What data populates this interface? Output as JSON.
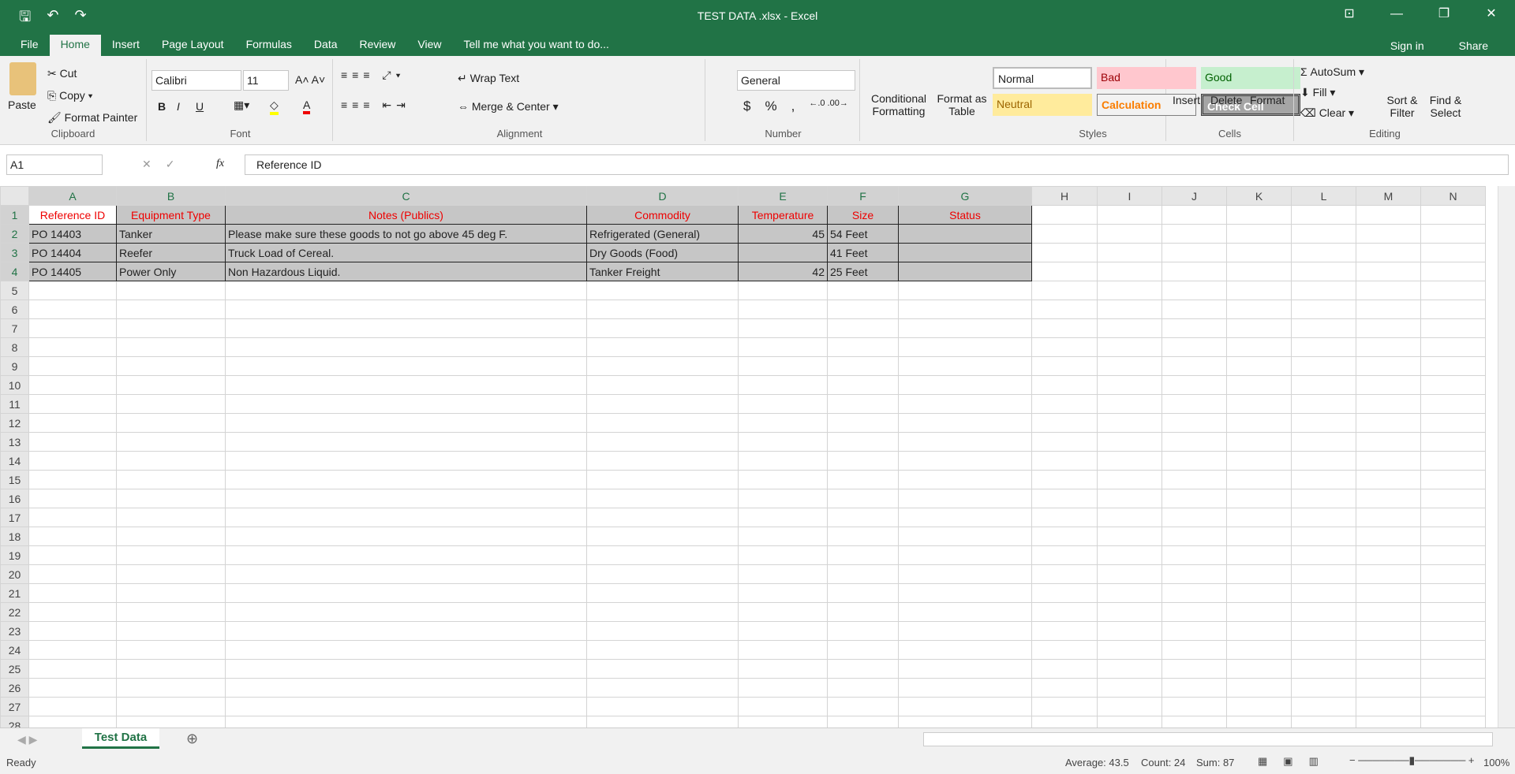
{
  "window": {
    "title": "TEST DATA .xlsx - Excel",
    "signin": "Sign in",
    "share": "Share"
  },
  "tabs": [
    "File",
    "Home",
    "Insert",
    "Page Layout",
    "Formulas",
    "Data",
    "Review",
    "View"
  ],
  "tell_me": "Tell me what you want to do...",
  "clipboard": {
    "paste": "Paste",
    "cut": "Cut",
    "copy": "Copy",
    "format_painter": "Format Painter",
    "label": "Clipboard"
  },
  "font": {
    "name": "Calibri",
    "size": "11",
    "bold": "B",
    "italic": "I",
    "underline": "U",
    "label": "Font"
  },
  "alignment": {
    "wrap": "Wrap Text",
    "merge": "Merge & Center",
    "label": "Alignment"
  },
  "number": {
    "format": "General",
    "currency": "$",
    "percent": "%",
    "comma": ",",
    "label": "Number"
  },
  "styles": {
    "conditional": "Conditional Formatting",
    "format_table": "Format as Table",
    "normal": "Normal",
    "bad": "Bad",
    "good": "Good",
    "neutral": "Neutral",
    "calculation": "Calculation",
    "check": "Check Cell",
    "label": "Styles"
  },
  "cells": {
    "insert": "Insert",
    "delete": "Delete",
    "format": "Format",
    "label": "Cells"
  },
  "editing": {
    "autosum": "AutoSum",
    "fill": "Fill",
    "clear": "Clear",
    "sort": "Sort & Filter",
    "find": "Find & Select",
    "label": "Editing"
  },
  "formula_bar": {
    "name_box": "A1",
    "fx": "fx",
    "value": "Reference ID"
  },
  "columns": [
    "A",
    "B",
    "C",
    "D",
    "E",
    "F",
    "G",
    "H",
    "I",
    "J",
    "K",
    "L",
    "M",
    "N"
  ],
  "sheet": {
    "headers": [
      "Reference ID",
      "Equipment Type",
      "Notes (Publics)",
      "Commodity",
      "Temperature",
      "Size",
      "Status"
    ],
    "rows": [
      [
        "PO 14403",
        "Tanker",
        "Please make sure these goods to not go above 45 deg F.",
        "Refrigerated (General)",
        "45",
        "54  Feet",
        ""
      ],
      [
        "PO 14404",
        "Reefer",
        "Truck Load of Cereal.",
        "Dry Goods (Food)",
        "",
        "41  Feet",
        ""
      ],
      [
        "PO 14405",
        "Power Only",
        "Non Hazardous Liquid.",
        "Tanker Freight",
        "42",
        "25  Feet",
        ""
      ]
    ]
  },
  "sheet_tab": "Test Data",
  "status": {
    "ready": "Ready",
    "average": "Average: 43.5",
    "count": "Count: 24",
    "sum": "Sum: 87",
    "zoom": "100%"
  }
}
